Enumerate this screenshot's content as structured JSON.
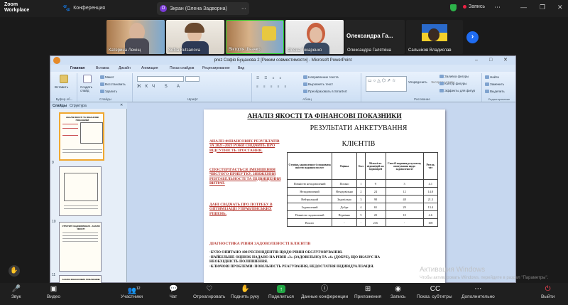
{
  "topbar": {
    "logo_line1": "Zoom",
    "logo_line2": "Workplace",
    "conference_label": "Конференция",
    "share_tab_label": "Экран (Олена Задворна)",
    "share_tab_avatar": "О",
    "record_label": "Запись",
    "icons": [
      "paw-icon",
      "shield-icon",
      "record-icon",
      "more-icon",
      "minimize-icon",
      "restore-icon",
      "close-icon"
    ]
  },
  "gallery": {
    "participants": [
      {
        "name": "Катерина Лемiщ"
      },
      {
        "name": "Sofiia Butsanova"
      },
      {
        "name": "Вiкторiя Швачко"
      },
      {
        "name": "Олена Токаренко"
      },
      {
        "name": "Олександра Галяткiна",
        "big_label": "Олександра  Га..."
      },
      {
        "name": "Сальнiков Владислав"
      }
    ],
    "next_icon": "chevron-right-icon"
  },
  "window": {
    "title": "prez Софiя Буцанова 2 [Режим совместимости] - Microsoft PowerPoint",
    "tabs": [
      "Главная",
      "Вставка",
      "Дизайн",
      "Анимация",
      "Показ слайдов",
      "Рецензирование",
      "Вид"
    ],
    "ribbon": {
      "paste_label": "Вставить",
      "create_slide_label": "Создать слайд",
      "layout_label": "Макет",
      "reset_label": "Восстановить",
      "delete_label": "Удалить",
      "text_direction": "Направление текста",
      "align_text": "Выровнять текст",
      "convert_smartart": "Преобразовать в SmartArt",
      "arrange_label": "Упорядочить",
      "quick_styles": "Экспресс-стили",
      "shape_fill": "Заливка фигуры",
      "shape_outline": "Контур фигуры",
      "shape_effects": "Эффекты для фигур",
      "find_label": "Найти",
      "replace_label": "Заменить",
      "select_label": "Выделить",
      "groups": [
        "Буфер об...",
        "Слайды",
        "Шрифт",
        "Абзац",
        "Рисование",
        "Редактирование"
      ]
    },
    "pane_tabs": [
      "Слайды",
      "Структура"
    ],
    "thumb_numbers": [
      "",
      "9",
      "10",
      "11"
    ],
    "thumb_titles": [
      "АНАЛІЗ ЯКОСТІ ТА ФІНАНСОВІ ПОКАЗНИКИ",
      "",
      "СТРАТЕГІЇ ЗАДОВОЛЕННЯ - АНАЛІЗ ЯКОСТІ",
      "АНАЛІЗ ФІНАНСОВИХ ПОКАЗНИКІВ"
    ]
  },
  "slide": {
    "title": "АНАЛІЗ ЯКОСТІ ТА ФІНАНСОВІ ПОКАЗНИКИ",
    "subtitle": "РЕЗУЛЬТАТИ АНКЕТУВАННЯ",
    "subtitle2": "КЛІЄНТІВ",
    "side_notes": [
      "АНАЛІЗ ФІНАНСОВИХ РЕЗУЛЬТАТІВ ЗА 2021–2023 РОКИ СВІДЧИТЬ ПРО ВІДСУТНІСТЬ ЗРОСТАННЯ.",
      "СПОСТЕРІГАЄТЬСЯ ЗМЕНШЕННЯ ЧИСТОГО ПРИБУТКУ, ЗНИЖЕННЯ РЕНТАБЕЛЬНОСТІ ТА ПІДВИЩЕННЯ ВИТРАТ.",
      "ДАНІ СВІДЧАТЬ ПРО ПОТРЕБУ В ОПТИМІЗАЦІЇ УПРАВЛІНСЬКИХ РІШЕНЬ."
    ],
    "table": {
      "headers": [
        "Ступінь задоволеності споживача якістю надання послуг",
        "Оцінка",
        "Бал",
        "Кількість відповідей на відповідей",
        "Спосіб надання результату опитування щодо задоволеності",
        "Резуль тат"
      ],
      "rows": [
        [
          "Повністю незадоволений",
          "Погано",
          "1",
          "9",
          "3",
          "4.1"
        ],
        [
          "Незадоволений",
          "Незадовільно",
          "2",
          "24",
          "12",
          "14.8"
        ],
        [
          "Нейтральний",
          "Задовільно",
          "3",
          "98",
          "48",
          "21.3"
        ],
        [
          "Задоволений",
          "Добре",
          "4",
          "65",
          "29",
          "13.4"
        ],
        [
          "Повністю задоволений",
          "Відмінно",
          "5",
          "20",
          "10",
          "4.6"
        ],
        [
          "Всього",
          "-",
          "-",
          "216",
          "-",
          "100"
        ]
      ]
    },
    "diag_title": "ДІАГНОСТИКА РІВНЯ ЗАДОВОЛЕНОСТІ КЛІЄНТІВ",
    "bottom_lines": [
      "·БУЛО ОПИТАНО 108 РЕСПОНДЕНТІВ ЩОДО РІВНЯ ОБСЛУГОВУВАННЯ.",
      "·НАЙБІЛЬШЕ ОЦІНОК НАДАНО НА РІВНІ «3» (ЗАДОВІЛЬНО) ТА «4» (ДОБРЕ), ЩО ВКАЗУЄ НА НЕОБХІДНІСТЬ ПОЛІПШЕННЯ.",
      "·КЛЮЧОВІ ПРОБЛЕМИ: ПОВІЛЬНІСТЬ РЕАГУВАННЯ, НЕДОСТАТНЯ ІНДИВІДУАЛІЗАЦІЯ."
    ]
  },
  "watermark": {
    "line1": "Активация Windows",
    "line2": "Чтобы активировать Windows, перейдите в раздел \"Параметры\"."
  },
  "toolbar": {
    "audio": "Звук",
    "video": "Видео",
    "participants": "Участники",
    "participants_count": "12",
    "chat": "Чат",
    "react": "Отреагировать",
    "raise_hand": "Поднять руку",
    "share": "Поделиться",
    "conf_data": "Данные конференции",
    "apps": "Приложения",
    "record": "Запись",
    "captions": "Показ. субтитры",
    "more": "Дополнительно",
    "leave": "Выйти"
  }
}
